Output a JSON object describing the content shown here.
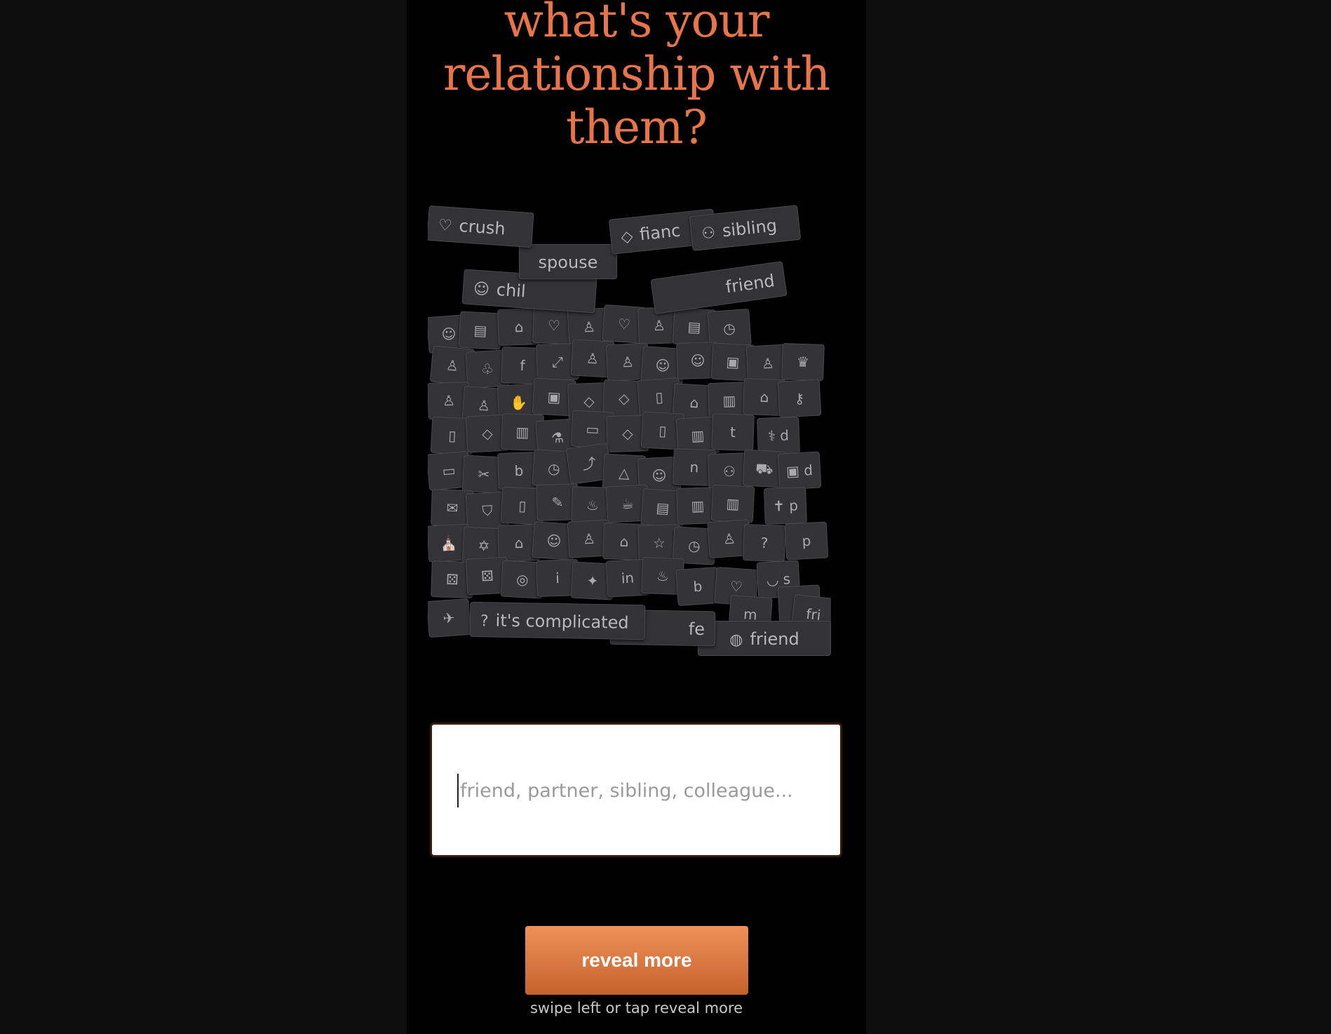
{
  "title": "what's your relationship with them?",
  "tags": {
    "crush": "crush",
    "fiance": "fianc",
    "sibling": "sibling",
    "spouse": "spouse",
    "child": "chil",
    "friend_top": "friend",
    "complicated": "it's complicated",
    "fe": "fe",
    "friend_bottom": "friend"
  },
  "input": {
    "placeholder": "friend, partner, sibling, colleague..."
  },
  "button": {
    "label": "reveal more"
  },
  "hint": "swipe left or tap reveal more",
  "colors": {
    "accent": "#e8744a",
    "button_top": "#f0915a",
    "button_bottom": "#c4622c",
    "tag_bg": "#333336"
  }
}
